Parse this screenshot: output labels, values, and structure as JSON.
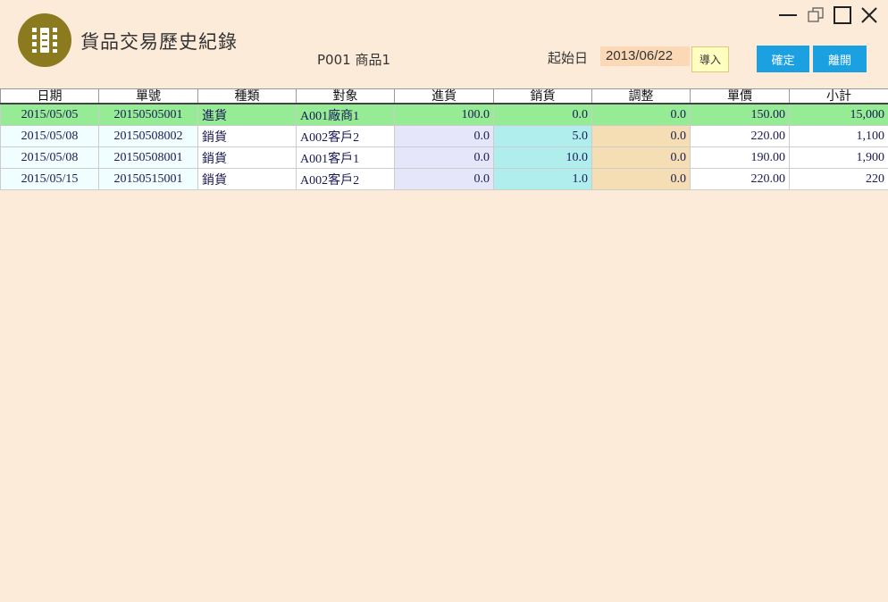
{
  "app": {
    "title": "貨品交易歷史紀錄",
    "logo_icon": "grid-app-icon"
  },
  "product": {
    "label": "P001 商品1"
  },
  "filter": {
    "start_label": "起始日",
    "start_value": "2013/06/22",
    "import_label": "導入"
  },
  "actions": {
    "ok_label": "確定",
    "exit_label": "離開"
  },
  "window_controls": [
    "minimize-icon",
    "restore-icon",
    "maximize-icon",
    "close-icon"
  ],
  "colors": {
    "background": "#fdebd9",
    "logo": "#8b7a1e",
    "button": "#1ba1e2",
    "selected_row": "#95ec95",
    "in_col": "#e6e6fa",
    "out_col": "#b0eeee",
    "adj_col": "#f5deb3"
  },
  "table": {
    "headers": [
      "日期",
      "單號",
      "種類",
      "對象",
      "進貨",
      "銷貨",
      "調整",
      "單價",
      "小計"
    ],
    "rows": [
      {
        "date": "2015/05/05",
        "no": "20150505001",
        "type": "進貨",
        "target": "A001廠商1",
        "in": "100.0",
        "out": "0.0",
        "adj": "0.0",
        "price": "150.00",
        "subtotal": "15,000"
      },
      {
        "date": "2015/05/08",
        "no": "20150508002",
        "type": "銷貨",
        "target": "A002客戶2",
        "in": "0.0",
        "out": "5.0",
        "adj": "0.0",
        "price": "220.00",
        "subtotal": "1,100"
      },
      {
        "date": "2015/05/08",
        "no": "20150508001",
        "type": "銷貨",
        "target": "A001客戶1",
        "in": "0.0",
        "out": "10.0",
        "adj": "0.0",
        "price": "190.00",
        "subtotal": "1,900"
      },
      {
        "date": "2015/05/15",
        "no": "20150515001",
        "type": "銷貨",
        "target": "A002客戶2",
        "in": "0.0",
        "out": "1.0",
        "adj": "0.0",
        "price": "220.00",
        "subtotal": "220"
      }
    ]
  }
}
